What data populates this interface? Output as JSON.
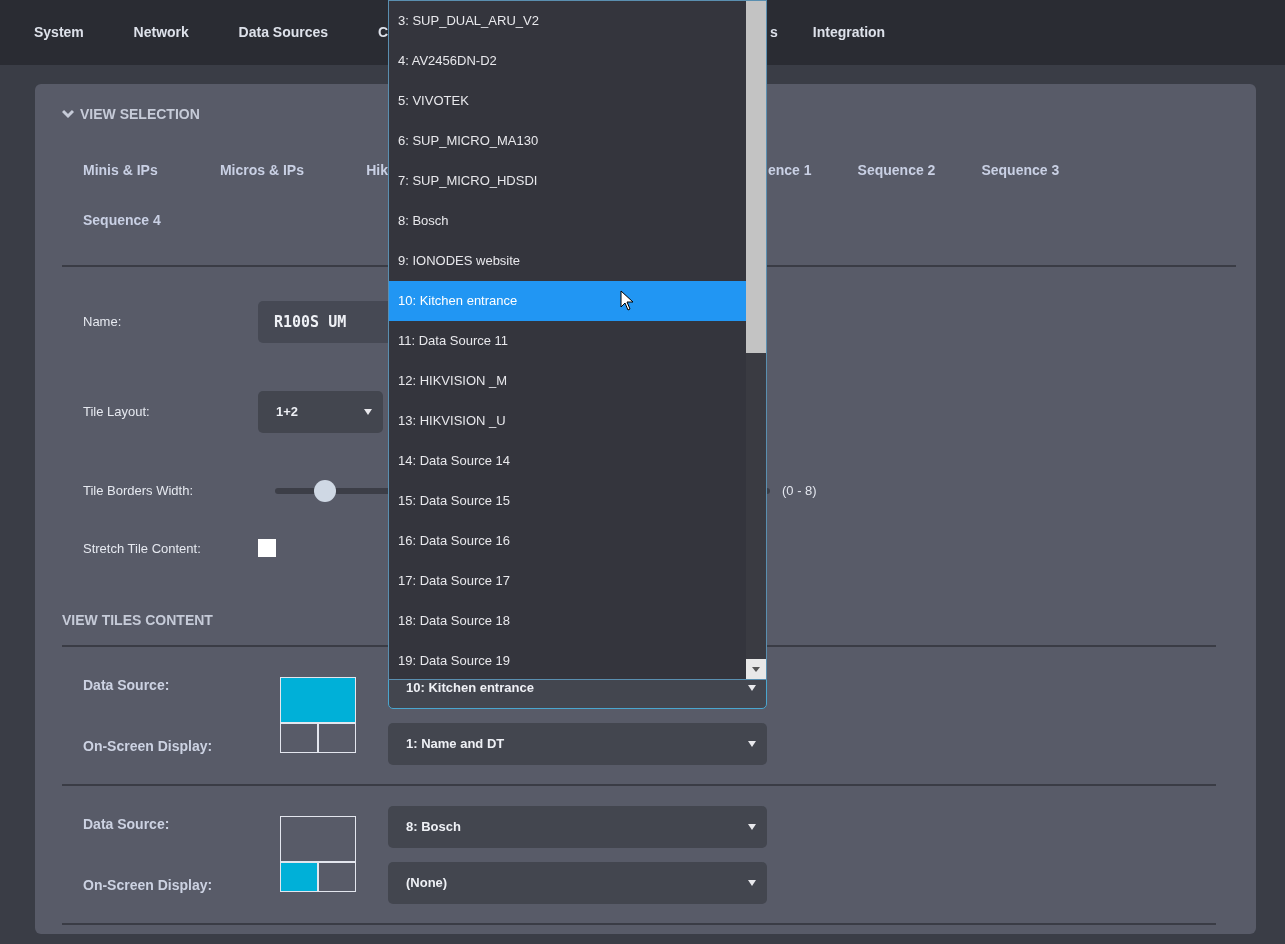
{
  "menu_bar": {
    "items_left_of_list": [
      "System",
      "Network",
      "Data Sources",
      "C"
    ],
    "items_right_of_list": [
      "s",
      "Integration"
    ]
  },
  "view_selection": {
    "title": "VIEW SELECTION",
    "expanded": true,
    "views_left_of_list": [
      "Minis & IPs",
      "Micros & IPs",
      "Hik"
    ],
    "views_right_of_list": [
      "ence 1",
      "Sequence 2",
      "Sequence 3"
    ],
    "views_second_line": [
      "Sequence 4"
    ]
  },
  "name": {
    "label": "Name:",
    "value": "R100S UM"
  },
  "tile_layout": {
    "label": "Tile Layout:",
    "value": "1+2"
  },
  "tile_borders_width": {
    "label": "Tile Borders Width:",
    "level": 0.1,
    "range": "(0 - 8)"
  },
  "stretch_tile_content": {
    "label": "Stretch Tile Content:",
    "checked": false
  },
  "view_tiles_content": {
    "title": "VIEW TILES CONTENT",
    "tiles": [
      {
        "data_source_label": "Data Source:",
        "data_source": "10: Kitchen entrance",
        "focused": true,
        "osd_label": "On-Screen Display:",
        "osd": "1: Name and DT",
        "cells": [
          {
            "selected": true
          },
          {
            "selected": false
          },
          {
            "selected": false
          }
        ]
      },
      {
        "data_source_label": "Data Source:",
        "data_source": "8: Bosch",
        "focused": false,
        "osd_label": "On-Screen Display:",
        "osd": "(None)",
        "cells": [
          {
            "selected": false
          },
          {
            "selected": true
          },
          {
            "selected": false
          }
        ]
      }
    ]
  },
  "dropdown_list": {
    "options": [
      {
        "label": "3: SUP_DUAL_ARU_V2",
        "selected": false
      },
      {
        "label": "4: AV2456DN-D2",
        "selected": false
      },
      {
        "label": "5: VIVOTEK",
        "selected": false
      },
      {
        "label": "6: SUP_MICRO_MA130",
        "selected": false
      },
      {
        "label": "7: SUP_MICRO_HDSDI",
        "selected": false
      },
      {
        "label": "8: Bosch",
        "selected": false
      },
      {
        "label": "9: IONODES website",
        "selected": false
      },
      {
        "label": "10: Kitchen entrance",
        "selected": true
      },
      {
        "label": "11: Data Source 11",
        "selected": false
      },
      {
        "label": "12: HIKVISION _M",
        "selected": false
      },
      {
        "label": "13: HIKVISION _U",
        "selected": false
      },
      {
        "label": "14: Data Source 14",
        "selected": false
      },
      {
        "label": "15: Data Source 15",
        "selected": false
      },
      {
        "label": "16: Data Source 16",
        "selected": false
      },
      {
        "label": "17: Data Source 17",
        "selected": false
      },
      {
        "label": "18: Data Source 18",
        "selected": false
      },
      {
        "label": "19: Data Source 19",
        "selected": false
      }
    ]
  }
}
